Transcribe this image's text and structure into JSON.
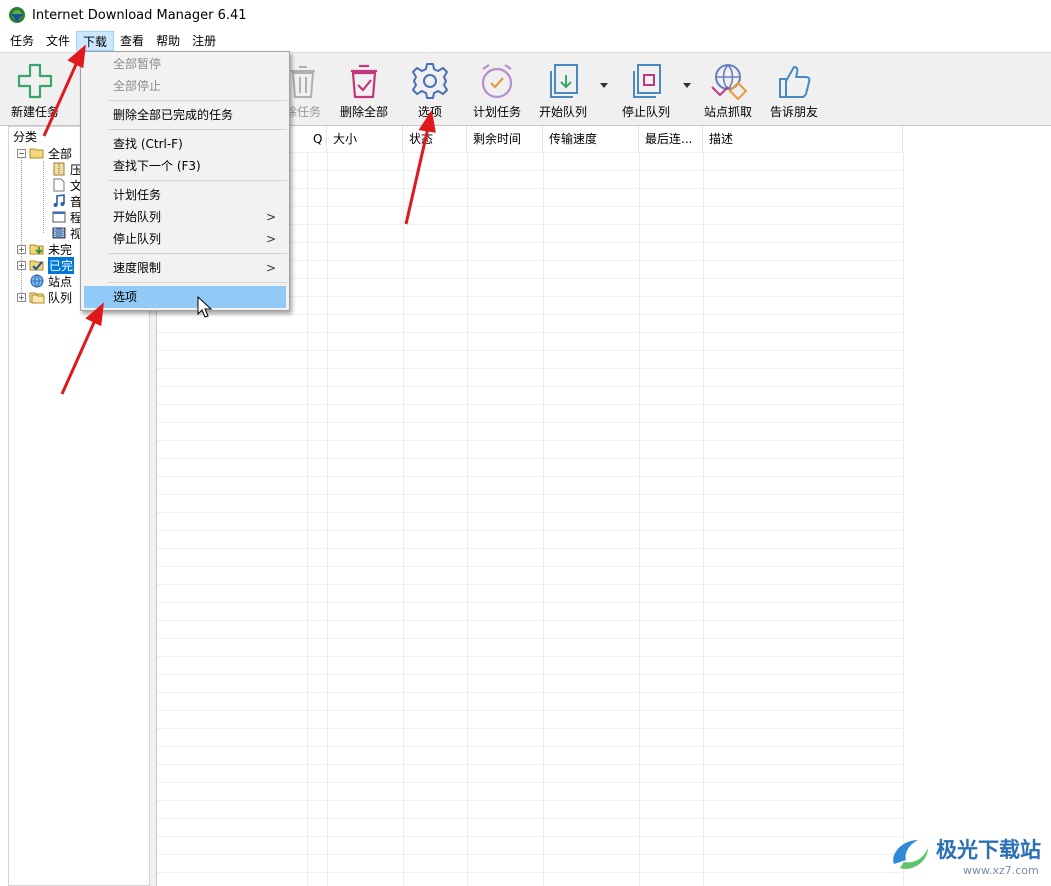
{
  "window": {
    "title": "Internet Download Manager 6.41"
  },
  "menubar": [
    {
      "label": "任务"
    },
    {
      "label": "文件"
    },
    {
      "label": "下载"
    },
    {
      "label": "查看"
    },
    {
      "label": "帮助"
    },
    {
      "label": "注册"
    }
  ],
  "toolbar": {
    "new_task": "新建任务",
    "delete_task": "除任务",
    "delete_all": "删除全部",
    "options": "选项",
    "scheduler": "计划任务",
    "start_queue": "开始队列",
    "stop_queue": "停止队列",
    "site_grabber": "站点抓取",
    "tell_friend": "告诉朋友"
  },
  "category": {
    "title": "分类",
    "items": [
      {
        "label": "全部"
      },
      {
        "label": "压"
      },
      {
        "label": "文"
      },
      {
        "label": "音"
      },
      {
        "label": "程"
      },
      {
        "label": "视"
      },
      {
        "label": "未完"
      },
      {
        "label": "已完"
      },
      {
        "label": "站点"
      },
      {
        "label": "队列"
      }
    ]
  },
  "list": {
    "columns": [
      "Q",
      "大小",
      "状态",
      "剩余时间",
      "传输速度",
      "最后连...",
      "描述"
    ]
  },
  "dropdown": {
    "items": [
      {
        "label": "全部暂停",
        "disabled": true
      },
      {
        "label": "全部停止",
        "disabled": true
      },
      {
        "label": "删除全部已完成的任务"
      },
      {
        "label": "查找 (Ctrl-F)"
      },
      {
        "label": "查找下一个 (F3)"
      },
      {
        "label": "计划任务"
      },
      {
        "label": "开始队列",
        "submenu": ">"
      },
      {
        "label": "停止队列",
        "submenu": ">"
      },
      {
        "label": "速度限制",
        "submenu": ">"
      },
      {
        "label": "选项",
        "hovered": true
      }
    ]
  },
  "watermark": {
    "brand": "极光下载站",
    "url": "www.xz7.com"
  },
  "colors": {
    "accent": "#0078d7",
    "menu_hover": "#91c9f7",
    "arrow": "#e0191d"
  }
}
